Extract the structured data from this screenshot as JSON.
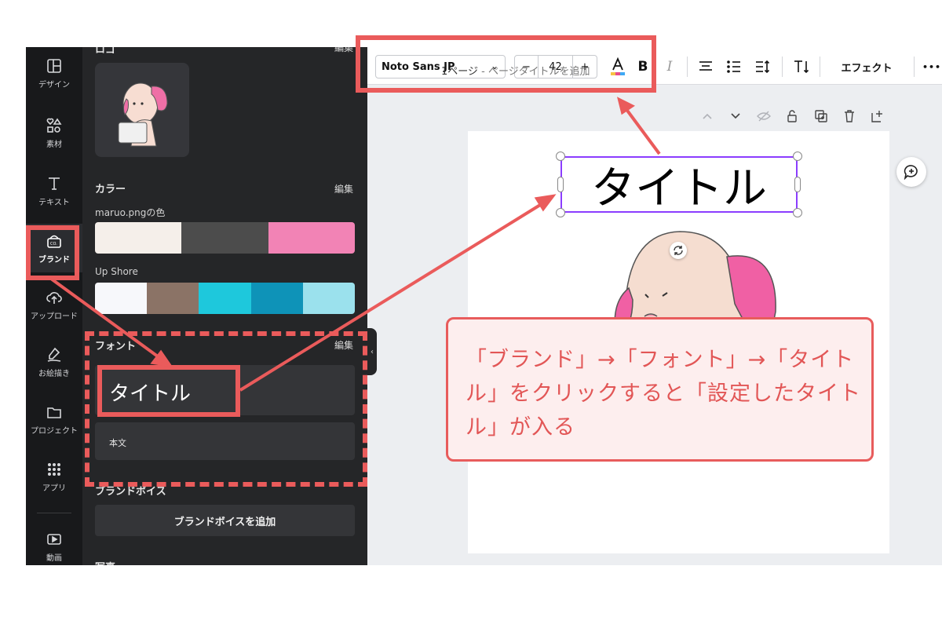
{
  "rail": {
    "items": [
      {
        "label": "デザイン",
        "icon": "layout-icon"
      },
      {
        "label": "素材",
        "icon": "shapes-icon"
      },
      {
        "label": "テキスト",
        "icon": "text-icon"
      },
      {
        "label": "ブランド",
        "icon": "brand-icon"
      },
      {
        "label": "アップロード",
        "icon": "cloud-upload-icon"
      },
      {
        "label": "お絵描き",
        "icon": "pen-icon"
      },
      {
        "label": "プロジェクト",
        "icon": "folder-icon"
      },
      {
        "label": "アプリ",
        "icon": "apps-grid-icon"
      },
      {
        "label": "動画",
        "icon": "video-icon"
      }
    ]
  },
  "panel": {
    "logo": {
      "heading": "ロゴ",
      "edit": "編集"
    },
    "colors": {
      "heading": "カラー",
      "edit": "編集",
      "palettes": [
        {
          "name": "maruo.pngの色",
          "swatches": [
            "#f5efea",
            "#4c4c4c",
            "#f283b5"
          ]
        },
        {
          "name": "Up Shore",
          "swatches": [
            "#f7f8fb",
            "#8b7366",
            "#1ec8dc",
            "#0e93b8",
            "#9be1ed"
          ]
        }
      ]
    },
    "fonts": {
      "heading": "フォント",
      "edit": "編集",
      "title_sample": "タイトル",
      "body_sample": "本文"
    },
    "brand_voice": {
      "heading": "ブランドボイス",
      "add_button": "ブランドボイスを追加"
    },
    "photos": {
      "heading": "写真"
    }
  },
  "toolbar": {
    "font_name": "Noto Sans JP",
    "font_size": "42",
    "minus": "−",
    "plus": "+",
    "bold": "B",
    "italic": "I",
    "effects": "エフェクト",
    "more": "•••"
  },
  "canvas": {
    "page_number": "1ページ",
    "page_title_placeholder": " - ページタイトルを追加",
    "title_text": "タイトル"
  },
  "annotation": {
    "callout_text": "「ブランド」→「フォント」→「タイトル」をクリックすると「設定したタイトル」が入る",
    "accent_color": "#ea5b5b"
  }
}
